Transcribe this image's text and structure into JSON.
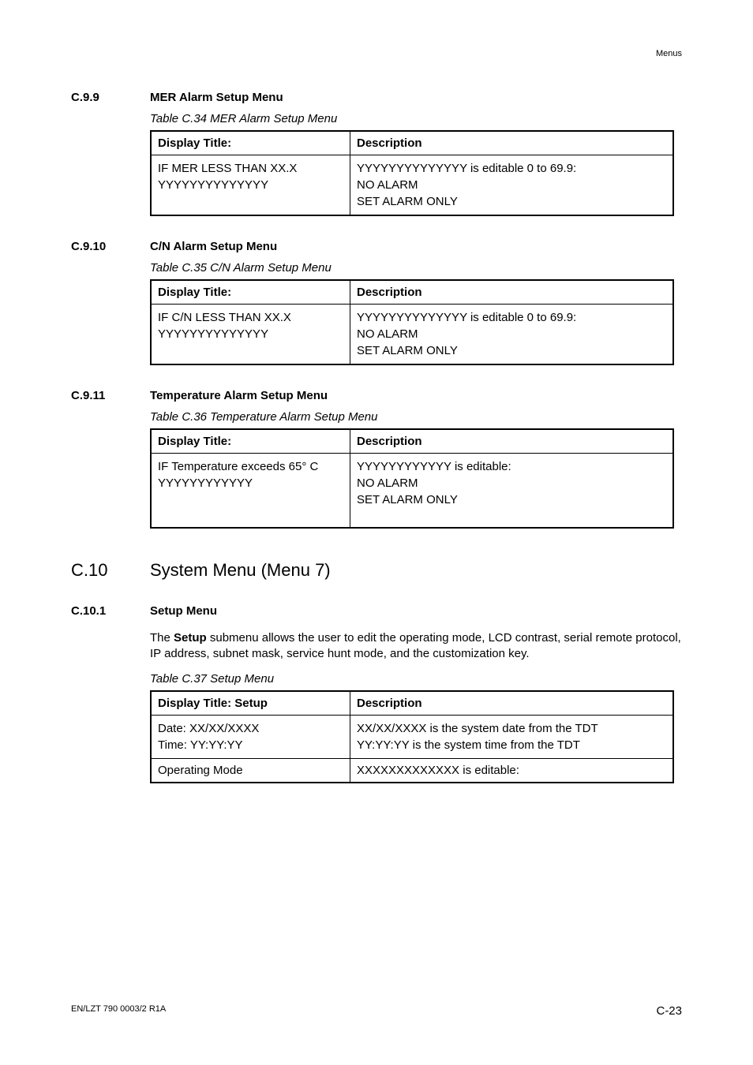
{
  "header": {
    "right": "Menus"
  },
  "sections": {
    "c99": {
      "num": "C.9.9",
      "title": "MER Alarm Setup Menu",
      "caption": "Table C.34 MER Alarm Setup Menu",
      "col1": "Display Title:",
      "col2": "Description",
      "r1c1a": "IF MER LESS THAN XX.X",
      "r1c1b": "YYYYYYYYYYYYYY",
      "r1c2a": "YYYYYYYYYYYYYY is editable 0 to 69.9:",
      "r1c2b": "NO ALARM",
      "r1c2c": "SET ALARM ONLY"
    },
    "c910": {
      "num": "C.9.10",
      "title": "C/N Alarm Setup Menu",
      "caption": "Table C.35 C/N Alarm Setup Menu",
      "col1": "Display Title:",
      "col2": "Description",
      "r1c1a": "IF C/N LESS THAN XX.X",
      "r1c1b": "YYYYYYYYYYYYYY",
      "r1c2a": "YYYYYYYYYYYYYY is editable 0 to 69.9:",
      "r1c2b": "NO ALARM",
      "r1c2c": "SET ALARM ONLY"
    },
    "c911": {
      "num": "C.9.11",
      "title": "Temperature Alarm Setup Menu",
      "caption": "Table C.36 Temperature Alarm Setup Menu",
      "col1": "Display Title:",
      "col2": "Description",
      "r1c1a": "IF Temperature exceeds 65° C",
      "r1c1b": "YYYYYYYYYYYY",
      "r1c2a": "YYYYYYYYYYYY is editable:",
      "r1c2b": "NO ALARM",
      "r1c2c": "SET ALARM ONLY"
    },
    "c10": {
      "num": "C.10",
      "title": "System Menu (Menu 7)"
    },
    "c101": {
      "num": "C.10.1",
      "title": "Setup Menu",
      "para_a": "The ",
      "para_b": "Setup",
      "para_c": " submenu allows the user to edit the operating mode, LCD contrast, serial remote protocol, IP address, subnet mask, service hunt mode, and the customization key.",
      "caption": "Table C.37 Setup Menu",
      "col1": "Display Title: Setup",
      "col2": "Description",
      "r1c1a": "Date: XX/XX/XXXX",
      "r1c1b": "Time: YY:YY:YY",
      "r1c2a": "XX/XX/XXXX is the system date from the TDT",
      "r1c2b": "YY:YY:YY is the system time from the TDT",
      "r2c1": "Operating Mode",
      "r2c2": "XXXXXXXXXXXXX is editable:"
    }
  },
  "footer": {
    "left": "EN/LZT 790 0003/2 R1A",
    "right": "C-23"
  }
}
